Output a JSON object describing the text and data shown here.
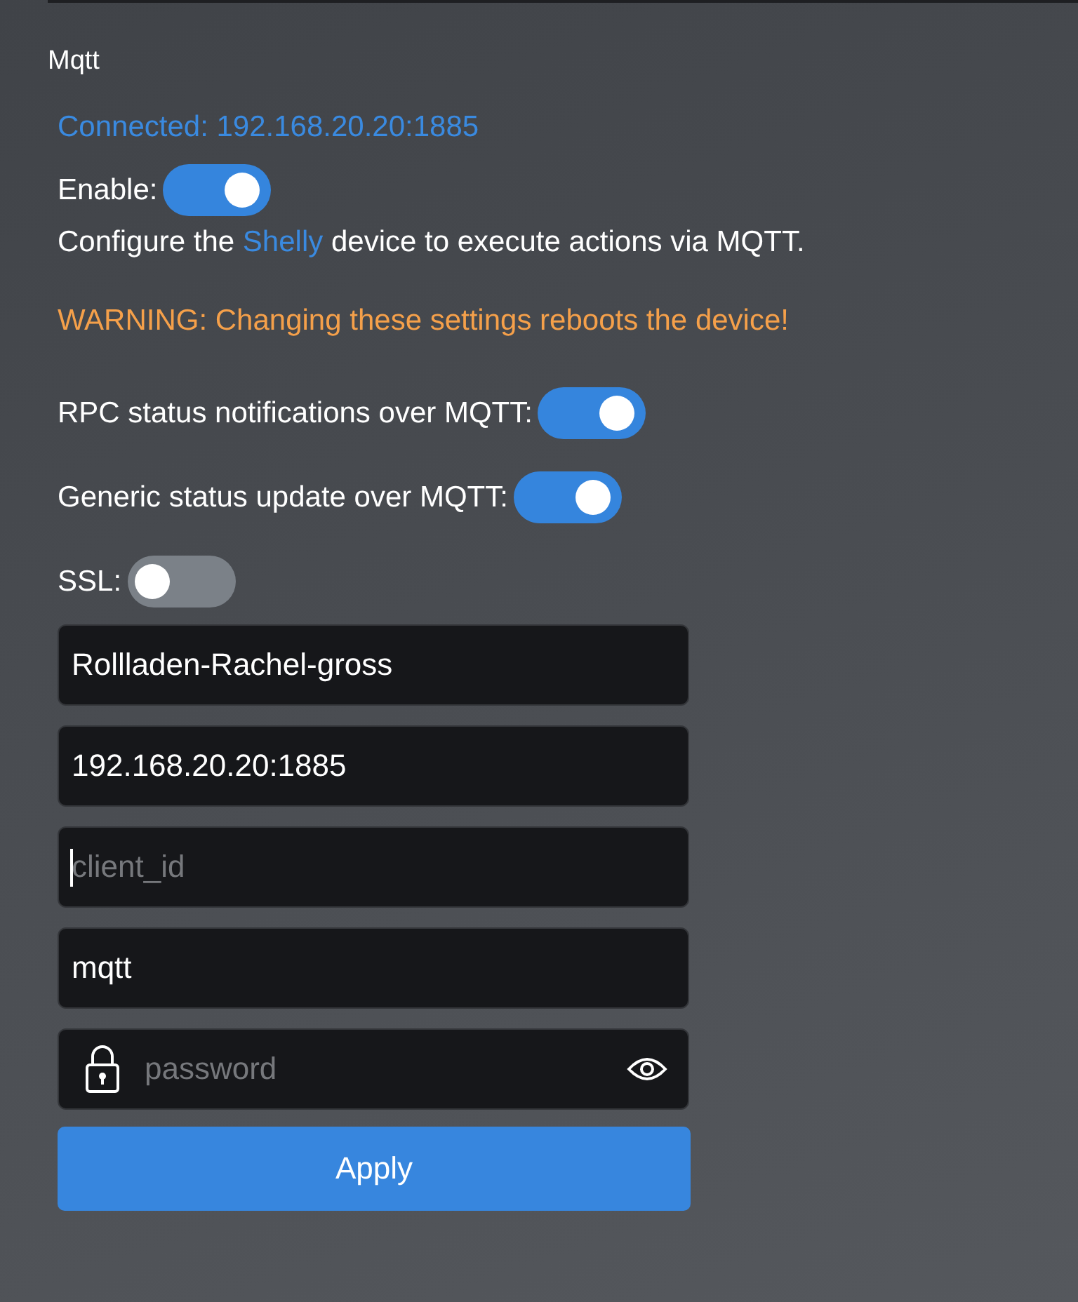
{
  "title": "Mqtt",
  "status": "Connected: 192.168.20.20:1885",
  "enable": {
    "label": "Enable:",
    "on": true
  },
  "description": {
    "before": "Configure the ",
    "link": "Shelly",
    "after": " device to execute actions via MQTT."
  },
  "warning": "WARNING: Changing these settings reboots the device!",
  "options": [
    {
      "label": "RPC status notifications over MQTT:",
      "on": true
    },
    {
      "label": "Generic status update over MQTT:",
      "on": true
    },
    {
      "label": "SSL:",
      "on": false
    }
  ],
  "fields": [
    {
      "kind": "text",
      "value": "Rollladen-Rachel-gross",
      "focused": false
    },
    {
      "kind": "text",
      "value": "192.168.20.20:1885",
      "focused": false
    },
    {
      "kind": "text",
      "placeholder": "client_id",
      "focused": true
    },
    {
      "kind": "text",
      "value": "mqtt",
      "focused": false
    },
    {
      "kind": "password",
      "placeholder": "password",
      "focused": false
    }
  ],
  "apply_button": "Apply"
}
